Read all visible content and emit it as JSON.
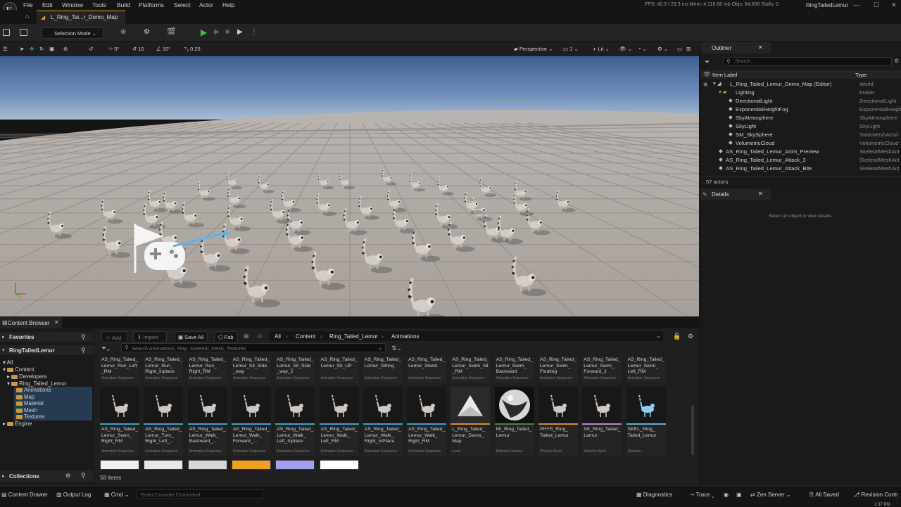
{
  "menu": [
    "File",
    "Edit",
    "Window",
    "Tools",
    "Build",
    "Platforms",
    "Select",
    "Actor",
    "Help"
  ],
  "stats": "FPS: 42.9  / 23.3 ms   Mem: 4,118.66 mb   Objs: 64,508   Stalls: 0",
  "project_name": "RingTailedLemur",
  "map_tab": "L_Ring_Tai...r_Demo_Map",
  "toolbar": {
    "selection_mode": "Selection Mode"
  },
  "viewport_toolbar": {
    "translate_snap": "0°",
    "rotate_snap": "10",
    "angle_snap": "10°",
    "scale_snap": "0.25",
    "perspective": "Perspective",
    "camera_speed": "1",
    "view_mode": "Lit"
  },
  "outliner": {
    "tab": "Outliner",
    "search_placeholder": "Search...",
    "col_label": "Item Label",
    "col_type": "Type",
    "rows": [
      {
        "label": "L_Ring_Tailed_Lemur_Demo_Map (Editor)",
        "type": "World",
        "indent": 0
      },
      {
        "label": "Lighting",
        "type": "Folder",
        "indent": 1
      },
      {
        "label": "DirectionalLight",
        "type": "DirectionalLight",
        "indent": 2
      },
      {
        "label": "ExponentialHeightFog",
        "type": "ExponentialHeightF",
        "indent": 2
      },
      {
        "label": "SkyAtmosphere",
        "type": "SkyAtmosphere",
        "indent": 2
      },
      {
        "label": "SkyLight",
        "type": "SkyLight",
        "indent": 2
      },
      {
        "label": "SM_SkySphere",
        "type": "StaticMeshActor",
        "indent": 2
      },
      {
        "label": "VolumetricCloud",
        "type": "VolumetricCloud",
        "indent": 2
      },
      {
        "label": "AS_Ring_Tailed_Lemur_Anim_Preview",
        "type": "SkeletalMeshAct",
        "indent": 1
      },
      {
        "label": "AS_Ring_Tailed_Lemur_Attack_3",
        "type": "SkeletalMeshAct",
        "indent": 1
      },
      {
        "label": "AS_Ring_Tailed_Lemur_Attack_Bite",
        "type": "SkeletalMeshAct",
        "indent": 1
      }
    ],
    "count": "57 actors"
  },
  "details": {
    "tab": "Details",
    "empty": "Select an object to view details."
  },
  "content_browser": {
    "tab": "Content Browser",
    "favorites": "Favorites",
    "project": "RingTailedLemur",
    "tree": {
      "all": "All",
      "content": "Content",
      "developers": "Developers",
      "lemur": "Ring_Tailed_Lemur",
      "animations": "Animations",
      "map": "Map",
      "material": "Material",
      "mesh": "Mesh",
      "textures": "Textures",
      "engine": "Engine"
    },
    "collections": "Collections",
    "add": "Add",
    "import": "Import",
    "save_all": "Save All",
    "fab": "Fab",
    "breadcrumb": [
      "All",
      "Content",
      "Ring_Tailed_Lemur",
      "Animations"
    ],
    "search_placeholder": "Search Animations, Map, Material, Mesh, Textures",
    "top_row": [
      {
        "name": "AS_Ring_Tailed_\nLemur_Run_Left\n_RM",
        "type": "Animation Sequence"
      },
      {
        "name": "AS_Ring_Tailed_\nLemur_Run_\nRight_Inplace",
        "type": "Animation Sequence"
      },
      {
        "name": "AS_Ring_Tailed_\nLemur_Run_\nRight_RM",
        "type": "Animation Sequence"
      },
      {
        "name": "AS_Ring_Tailed_\nLemur_Sit_Side\n_way",
        "type": "Animation Sequence"
      },
      {
        "name": "AS_Ring_Tailed_\nLemur_Sit_Side\n_way_2",
        "type": "Animation Sequence"
      },
      {
        "name": "AS_Ring_Tailed_\nLemur_Sit_UP",
        "type": "Animation Sequence"
      },
      {
        "name": "AS_Ring_Tailed_\nLemur_Sitting",
        "type": "Animation Sequence"
      },
      {
        "name": "AS_Ring_Tailed_\nLemur_Stand",
        "type": "Animation Sequence"
      },
      {
        "name": "AS_Ring_Tailed_\nLemur_Swim_All\n_RM",
        "type": "Animation Sequence"
      },
      {
        "name": "AS_Ring_Tailed_\nLemur_Swim_\nBackward",
        "type": "Animation Sequence"
      },
      {
        "name": "AS_Ring_Tailed_\nLemur_Swim_\nFloating",
        "type": "Animation Sequence"
      },
      {
        "name": "AS_Ring_Tailed_\nLemur_Swim_\nForward_2",
        "type": "Animation Sequence"
      },
      {
        "name": "AS_Ring_Tailed_\nLemur_Swim_\nLeft_RM",
        "type": "Animation Sequence"
      }
    ],
    "mid_row": [
      {
        "name": "AS_Ring_Tailed_\nLemur_Swim_\nRight_RM",
        "type": "Animation Sequence",
        "kind": "lemur",
        "color": "#3aa0d8"
      },
      {
        "name": "AS_Ring_Tailed_\nLemur_Turn_\nRight_Left_...",
        "type": "Animation Sequence",
        "kind": "lemur",
        "color": "#3aa0d8"
      },
      {
        "name": "AS_Ring_Tailed_\nLemur_Walk_\nBackward_...",
        "type": "Animation Sequence",
        "kind": "lemur",
        "color": "#3aa0d8"
      },
      {
        "name": "AS_Ring_Tailed_\nLemur_Walk_\nForward_...",
        "type": "Animation Sequence",
        "kind": "lemur",
        "color": "#3aa0d8"
      },
      {
        "name": "AS_Ring_Tailed_\nLemur_Walk_\nLeft_Inplace",
        "type": "Animation Sequence",
        "kind": "lemur",
        "color": "#3aa0d8"
      },
      {
        "name": "AS_Ring_Tailed_\nLemur_Walk_\nLeft_RM",
        "type": "Animation Sequence",
        "kind": "lemur",
        "color": "#3aa0d8"
      },
      {
        "name": "AS_Ring_Tailed_\nLemur_Walk_\nRight_InPlace",
        "type": "Animation Sequence",
        "kind": "lemur",
        "color": "#3aa0d8"
      },
      {
        "name": "AS_Ring_Tailed_\nLemur_Walk_\nRight_RM",
        "type": "Animation Sequence",
        "kind": "lemur",
        "color": "#3aa0d8"
      },
      {
        "name": "L_Ring_Tailed_\nLemur_Demo_\nMap",
        "type": "Level",
        "kind": "level",
        "color": "#e08a2a"
      },
      {
        "name": "MI_Ring_Tailed_\nLemur",
        "type": "Material Instance",
        "kind": "sphere",
        "color": "#3a8a3a"
      },
      {
        "name": "PHYS_Ring_\nTailed_Lemur",
        "type": "Physics Asset",
        "kind": "lemur",
        "color": "#d8882a"
      },
      {
        "name": "SK_Ring_Tailed_\nLemur",
        "type": "Skeletal Mesh",
        "kind": "lemur",
        "color": "#c87ad8"
      },
      {
        "name": "SKEL_Ring_\nTailed_Lemur",
        "type": "Skeleton",
        "kind": "skel",
        "color": "#5ab0d8"
      }
    ],
    "bottom_thumbs": [
      "#f0f0f0",
      "#e8e8e8",
      "#d8d8d8",
      "#f0a020",
      "#a0a0f0",
      "#ffffff"
    ],
    "item_count": "58 items"
  },
  "statusbar": {
    "content_drawer": "Content Drawer",
    "output_log": "Output Log",
    "cmd": "Cmd",
    "console_placeholder": "Enter Console Command",
    "diagnostics": "Diagnostics",
    "trace": "Trace",
    "zen": "Zen Server",
    "saved": "All Saved",
    "revision": "Revision Contr"
  },
  "clock": "1:37 PM"
}
